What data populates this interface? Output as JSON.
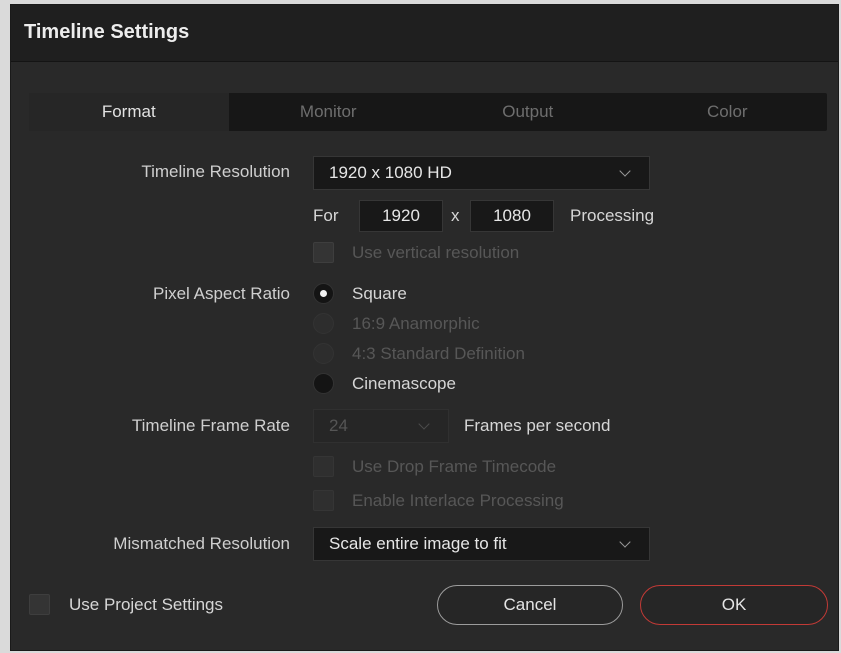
{
  "window": {
    "title": "Timeline Settings"
  },
  "tabs": [
    {
      "label": "Format",
      "active": true
    },
    {
      "label": "Monitor",
      "active": false
    },
    {
      "label": "Output",
      "active": false
    },
    {
      "label": "Color",
      "active": false
    }
  ],
  "format": {
    "timeline_resolution": {
      "label": "Timeline Resolution",
      "value": "1920 x 1080 HD",
      "for_label": "For",
      "width": "1920",
      "x_label": "x",
      "height": "1080",
      "processing_label": "Processing",
      "use_vertical_label": "Use vertical resolution",
      "use_vertical_checked": false
    },
    "pixel_aspect": {
      "label": "Pixel Aspect Ratio",
      "options": [
        {
          "label": "Square",
          "selected": true,
          "enabled": true
        },
        {
          "label": "16:9 Anamorphic",
          "selected": false,
          "enabled": false
        },
        {
          "label": "4:3 Standard Definition",
          "selected": false,
          "enabled": false
        },
        {
          "label": "Cinemascope",
          "selected": false,
          "enabled": true
        }
      ]
    },
    "frame_rate": {
      "label": "Timeline Frame Rate",
      "value": "24",
      "unit_label": "Frames per second",
      "drop_frame_label": "Use Drop Frame Timecode",
      "interlace_label": "Enable Interlace Processing"
    },
    "mismatched": {
      "label": "Mismatched Resolution",
      "value": "Scale entire image to fit"
    }
  },
  "footer": {
    "use_project_label": "Use Project Settings",
    "use_project_checked": false,
    "cancel_label": "Cancel",
    "ok_label": "OK"
  },
  "colors": {
    "ok_border": "#c23a36",
    "background": "#292929",
    "tab_active": "#262626"
  }
}
